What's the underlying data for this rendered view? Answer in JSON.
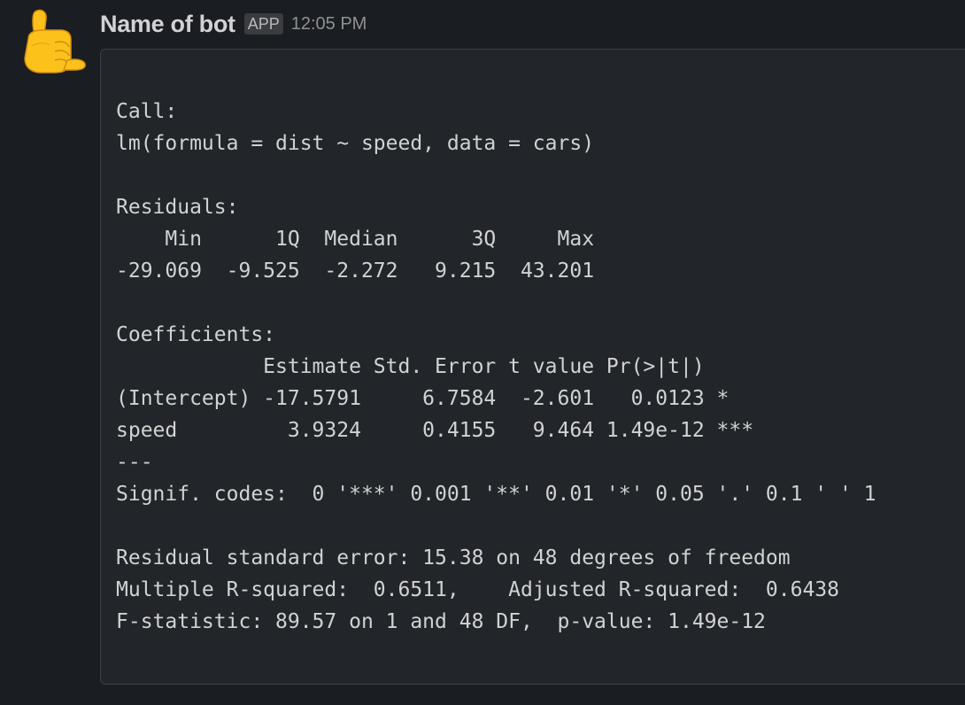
{
  "message": {
    "author": "Name of bot",
    "badge": "APP",
    "time": "12:05 PM",
    "avatar": "call-me-hand-emoji",
    "code_lines": [
      "Call:",
      "lm(formula = dist ~ speed, data = cars)",
      "",
      "Residuals:",
      "    Min      1Q  Median      3Q     Max ",
      "-29.069  -9.525  -2.272   9.215  43.201 ",
      "",
      "Coefficients:",
      "            Estimate Std. Error t value Pr(>|t|)    ",
      "(Intercept) -17.5791     6.7584  -2.601   0.0123 *  ",
      "speed         3.9324     0.4155   9.464 1.49e-12 ***",
      "---",
      "Signif. codes:  0 '***' 0.001 '**' 0.01 '*' 0.05 '.' 0.1 ' ' 1",
      "",
      "Residual standard error: 15.38 on 48 degrees of freedom",
      "Multiple R-squared:  0.6511,\tAdjusted R-squared:  0.6438 ",
      "F-statistic: 89.57 on 1 and 48 DF,  p-value: 1.49e-12"
    ]
  },
  "colors": {
    "background": "#1a1d21",
    "code_background": "#222529",
    "text": "#d1d2d3",
    "timestamp": "#8f9094"
  }
}
